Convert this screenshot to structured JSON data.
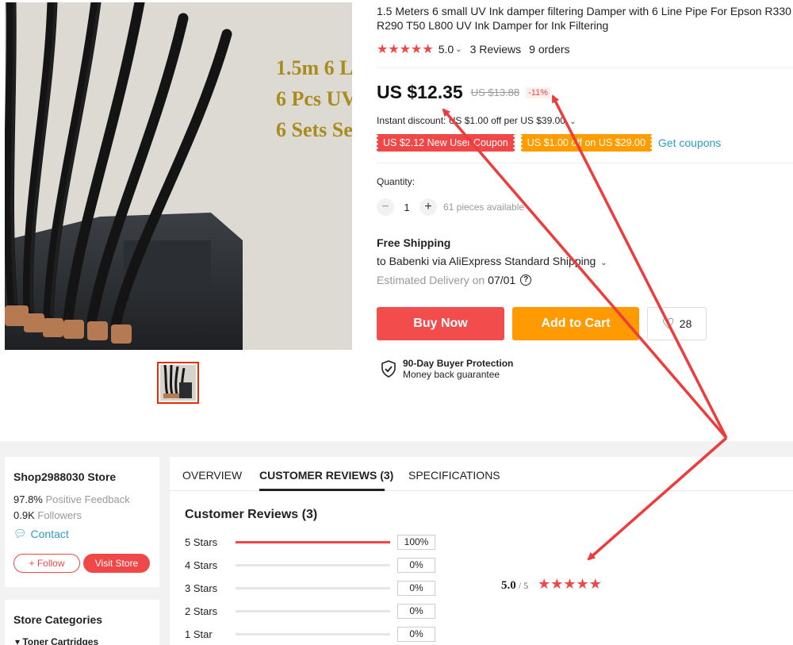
{
  "product": {
    "title_line1": "1.5 Meters 6 small UV Ink damper filtering Damper with 6 Line Pipe For Epson R330",
    "title_line2": "R290 T50 L800 UV Ink Damper for Ink Filtering",
    "image_text": [
      "1.5m 6 L",
      "6 Pcs UV",
      "6 Sets Se"
    ],
    "stars": "★★★★★",
    "rating": "5.0",
    "reviews": "3 Reviews",
    "orders": "9 orders"
  },
  "price": {
    "current": "US $12.35",
    "original": "US $13.88",
    "discount": "-11%",
    "instant_discount": "Instant discount: US $1.00 off per US $39.00",
    "coupons": [
      "US $2.12 New User Coupon",
      "US $1.00 off on US $29.00"
    ],
    "get_coupons": "Get coupons"
  },
  "quantity": {
    "label": "Quantity:",
    "minus": "−",
    "value": "1",
    "plus": "+",
    "available": "61 pieces available"
  },
  "shipping": {
    "title": "Free Shipping",
    "line": "to Babenki via AliExpress Standard Shipping",
    "delivery_label": "Estimated Delivery on",
    "delivery_date": "07/01",
    "help": "?"
  },
  "actions": {
    "buy_now": "Buy Now",
    "add_to_cart": "Add to Cart",
    "wishlist_count": "28"
  },
  "protection": {
    "title": "90-Day Buyer Protection",
    "subtitle": "Money back guarantee"
  },
  "store": {
    "name": "Shop2988030 Store",
    "feedback_value": "97.8%",
    "feedback_label": "Positive Feedback",
    "followers_value": "0.9K",
    "followers_label": "Followers",
    "contact": "Contact",
    "follow": "Follow",
    "visit": "Visit Store",
    "categories_title": "Store Categories",
    "first_category": "Toner Cartridges"
  },
  "tabs": [
    "OVERVIEW",
    "CUSTOMER REVIEWS (3)",
    "SPECIFICATIONS"
  ],
  "reviews": {
    "heading": "Customer Reviews (3)",
    "breakdown": [
      {
        "label": "5 Stars",
        "percent": 100,
        "text": "100%"
      },
      {
        "label": "4 Stars",
        "percent": 0,
        "text": "0%"
      },
      {
        "label": "3 Stars",
        "percent": 0,
        "text": "0%"
      },
      {
        "label": "2 Stars",
        "percent": 0,
        "text": "0%"
      },
      {
        "label": "1 Star",
        "percent": 0,
        "text": "0%"
      }
    ],
    "average": "5.0",
    "max": "/ 5",
    "stars": "★★★★★"
  },
  "colors": {
    "accent_red": "#f04848",
    "accent_orange": "#ff9a00",
    "link_blue": "#2e9cc3",
    "annotation_arrow": "#ee3b3b"
  }
}
